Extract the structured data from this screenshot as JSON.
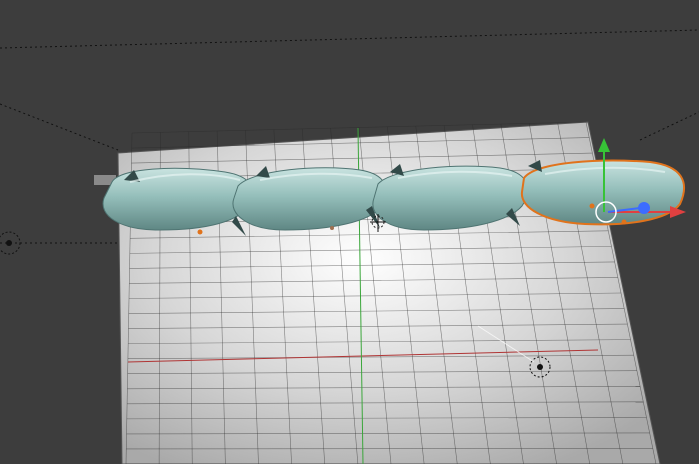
{
  "viewport": {
    "background_color": "#3d3d3d",
    "plane_color": "#d8d8d8",
    "grid_color": "#2a2a2a",
    "x_axis_color": "#b03535",
    "y_axis_color": "#3aa63a",
    "mesh_color": "#8fb8b4",
    "mesh_shadow_color": "#4f7472",
    "selection_outline_color": "#e0731c",
    "gizmo": {
      "x_arrow_color": "#e04040",
      "y_arrow_color": "#37c337",
      "z_arrow_color": "#3c6cff",
      "handle_color": "#ffffff"
    },
    "objects": {
      "mesh": "twisted-rope-mesh",
      "lamp": "lamp-icon",
      "camera": "camera-icon",
      "cursor": "3d-cursor-icon"
    }
  }
}
